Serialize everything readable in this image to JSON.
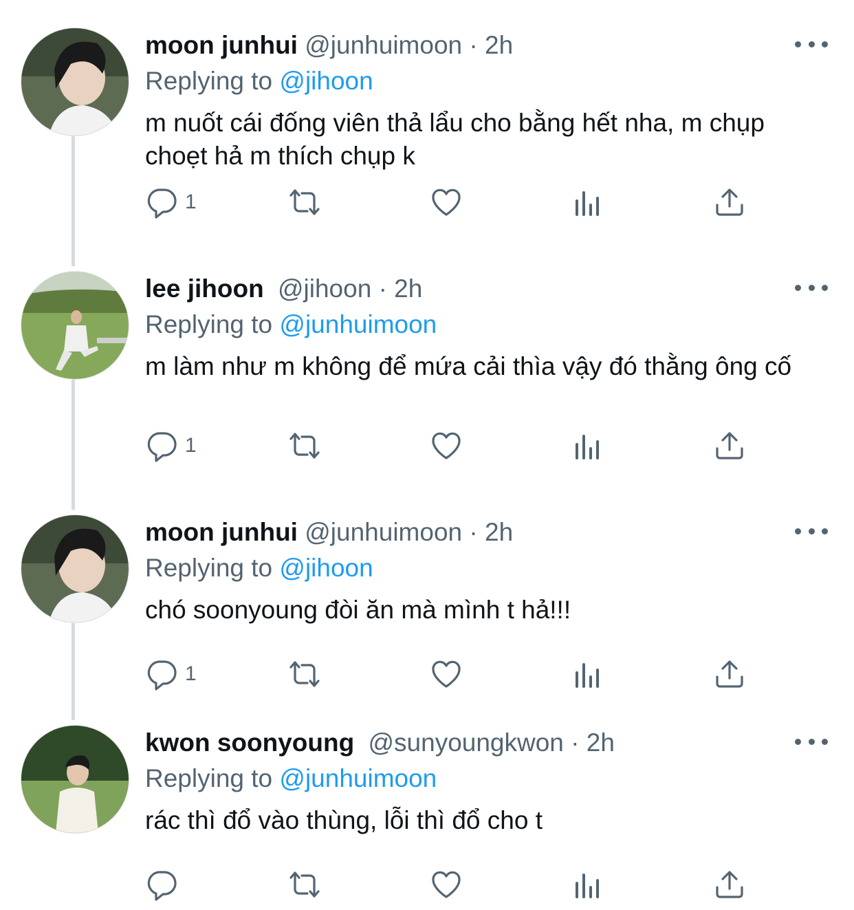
{
  "tweets": [
    {
      "name": "moon junhui",
      "handle": "@junhuimoon",
      "dot": "·",
      "time": "2h",
      "replying_prefix": "Replying to",
      "replying_to": "@jihoon",
      "text": " m nuốt cái đống viên thả lẩu cho bằng hết nha, m chụp choẹt hả m thích chụp k",
      "reply_count": "1",
      "avatar": "avatar-moon-junhui"
    },
    {
      "name": "lee jihoon",
      "handle": "@jihoon",
      "dot": "·",
      "time": "2h",
      "replying_prefix": "Replying to",
      "replying_to": "@junhuimoon",
      "text": "m làm như m không để mứa cải thìa vậy đó thằng ông cố",
      "reply_count": "1",
      "avatar": "avatar-lee-jihoon"
    },
    {
      "name": "moon junhui",
      "handle": "@junhuimoon",
      "dot": "·",
      "time": "2h",
      "replying_prefix": "Replying to",
      "replying_to": "@jihoon",
      "text": "chó soonyoung đòi ăn mà mình t hả!!!",
      "reply_count": "1",
      "avatar": "avatar-moon-junhui"
    },
    {
      "name": "kwon soonyoung",
      "handle": "@sunyoungkwon",
      "dot": "·",
      "time": "2h",
      "replying_prefix": "Replying to",
      "replying_to": "@junhuimoon",
      "text": "rác thì đổ vào thùng, lỗi thì đổ cho t",
      "reply_count": "",
      "avatar": "avatar-kwon-soonyoung"
    }
  ],
  "icons": {
    "reply": "reply-icon",
    "retweet": "retweet-icon",
    "like": "heart-icon",
    "analytics": "analytics-icon",
    "share": "share-icon",
    "more": "more-icon"
  },
  "colors": {
    "text": "#0f1419",
    "secondary": "#536471",
    "link": "#1d9bf0",
    "thread_line": "#d5dbe1"
  }
}
